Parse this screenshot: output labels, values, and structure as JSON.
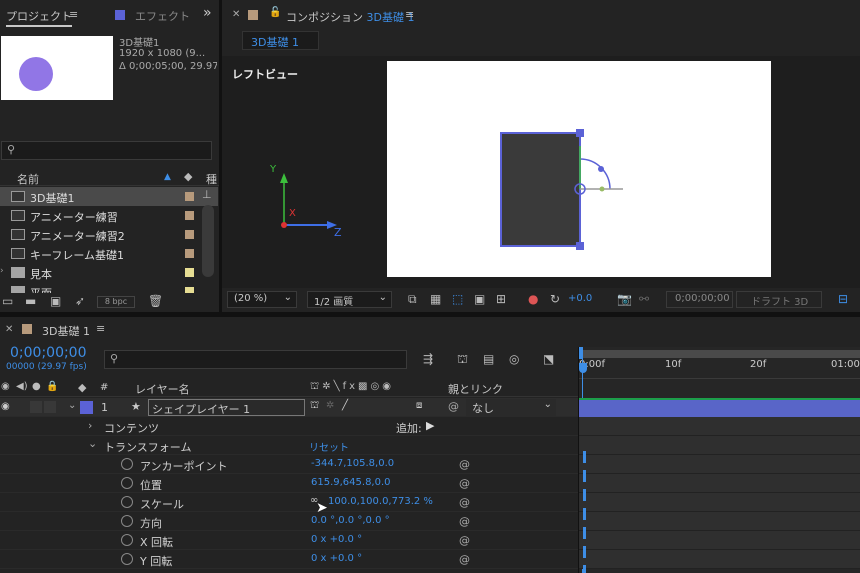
{
  "project_panel": {
    "tab_project": "プロジェクト",
    "tab_effects": "エフェクト",
    "overflow_icon": "»",
    "thumb_name": "3D基礎1",
    "thumb_res": "1920 x 1080  (9...",
    "thumb_duration": "Δ 0;00;05;00, 29.97",
    "col_name": "名前",
    "col_type": "種",
    "bpc": "8 bpc",
    "items": [
      {
        "name": "3D基礎1",
        "type": "comp",
        "selected": true
      },
      {
        "name": "アニメーター練習",
        "type": "comp"
      },
      {
        "name": "アニメーター練習2",
        "type": "comp"
      },
      {
        "name": "キーフレーム基礎1",
        "type": "comp"
      },
      {
        "name": "見本",
        "type": "folder"
      },
      {
        "name": "平面",
        "type": "folder"
      }
    ]
  },
  "comp_panel": {
    "tab_label": "コンポジション",
    "tab_comp_name": "3D基礎 1",
    "subtab": "3D基礎 1",
    "view_label": "レフトビュー",
    "zoom": "(20 %)",
    "resolution": "1/2 画質",
    "exposure": "+0.0",
    "timecode": "0;00;00;00",
    "draft3d": "ドラフト 3D",
    "axes": {
      "y": "Y",
      "x": "X",
      "z": "Z"
    }
  },
  "timeline_panel": {
    "tab_name": "3D基礎 1",
    "current_time": "0;00;00;00",
    "frame_info": "00000 (29.97 fps)",
    "col_num": "#",
    "col_layer_name": "レイヤー名",
    "col_parent": "親とリンク",
    "layer": {
      "index": "1",
      "name": "シェイプレイヤー 1",
      "parent": "なし"
    },
    "contents_label": "コンテンツ",
    "add_label": "追加:",
    "transform_label": "トランスフォーム",
    "reset_label": "リセット",
    "properties": [
      {
        "name": "アンカーポイント",
        "value": "-344.7,105.8,0.0"
      },
      {
        "name": "位置",
        "value": "615.9,645.8,0.0"
      },
      {
        "name": "スケール",
        "value": "100.0,100.0,773.2 %"
      },
      {
        "name": "方向",
        "value": "0.0 °,0.0 °,0.0 °"
      },
      {
        "name": "X 回転",
        "value": "0 x +0.0 °"
      },
      {
        "name": "Y 回転",
        "value": "0 x +0.0 °"
      }
    ],
    "ruler_ticks": [
      "0:00f",
      "10f",
      "20f",
      "01:00f"
    ],
    "colors": {
      "accent": "#3e8ee6",
      "layer_bar": "#5965c8",
      "label_tan": "#b79a7c",
      "label_yellow": "#e6dd93"
    }
  }
}
